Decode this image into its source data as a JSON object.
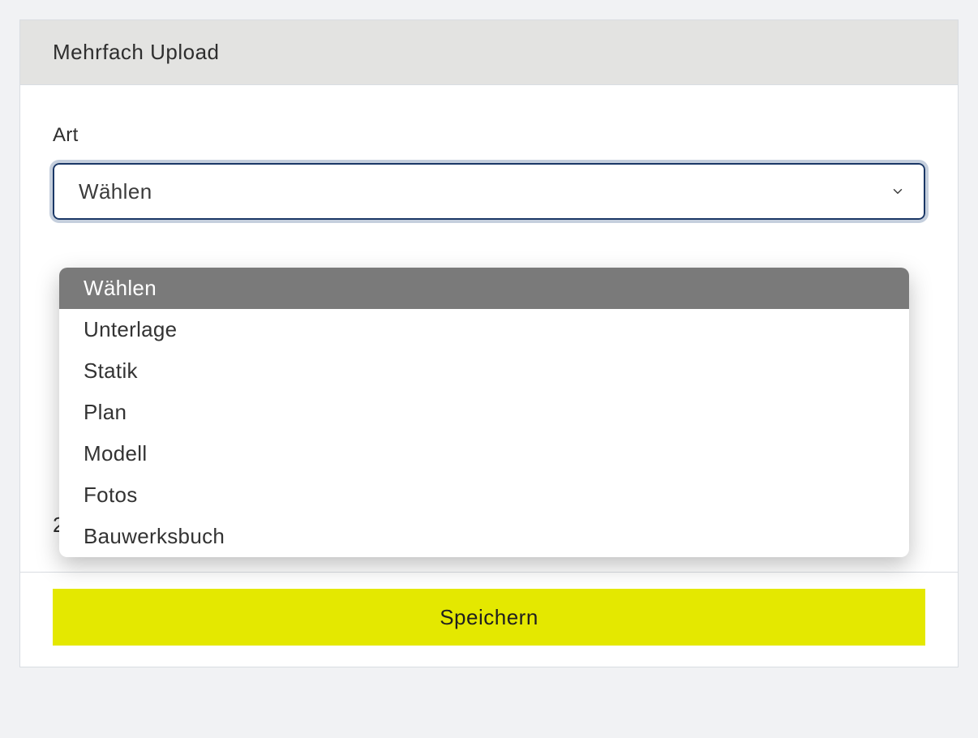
{
  "card": {
    "title": "Mehrfach Upload"
  },
  "form": {
    "art_label": "Art",
    "art_selected": "Wählen",
    "art_options": [
      "Wählen",
      "Unterlage",
      "Statik",
      "Plan",
      "Modell",
      "Fotos",
      "Bauwerksbuch"
    ],
    "hint_partial": "20 MB pro Datei, 20 MB insgesamt"
  },
  "footer": {
    "save_label": "Speichern"
  },
  "colors": {
    "accent": "#e4e800",
    "select_border": "#1a3766",
    "highlight": "#7a7a7a"
  }
}
